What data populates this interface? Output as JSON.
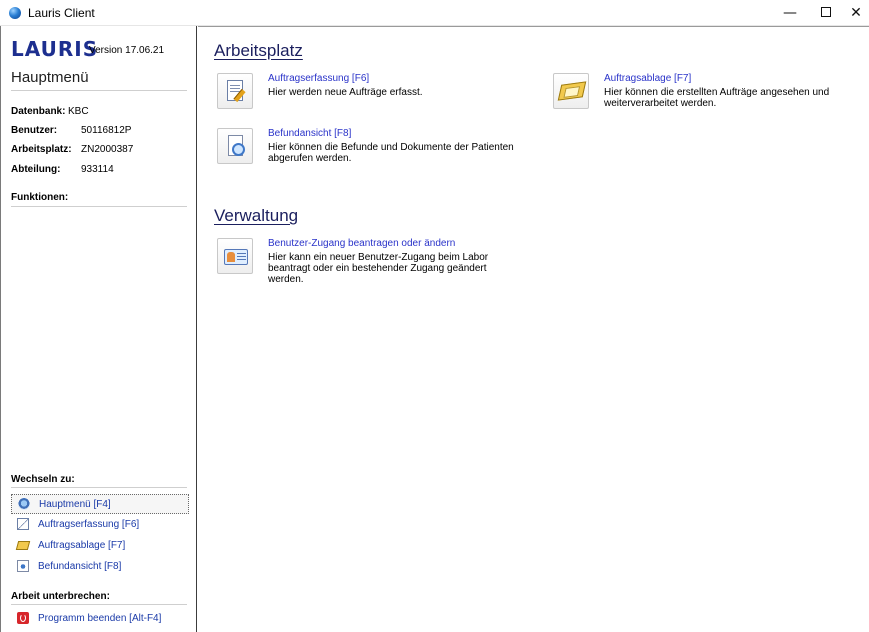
{
  "window": {
    "title": "Lauris Client",
    "controls": {
      "minimize": "—",
      "close": "✕"
    }
  },
  "sidebar": {
    "logo": "LAURIS",
    "version": "Version 17.06.21",
    "title": "Hauptmenü",
    "info": [
      {
        "label": "Datenbank:",
        "value": "KBC"
      },
      {
        "label": "Benutzer:",
        "value": "50116812P"
      },
      {
        "label": "Arbeitsplatz:",
        "value": "ZN2000387"
      },
      {
        "label": "Abteilung:",
        "value": "933114"
      }
    ],
    "functions_heading": "Funktionen:",
    "switch_heading": "Wechseln zu:",
    "nav": [
      {
        "label": "Hauptmenü [F4]",
        "icon": "home-icon",
        "selected": true
      },
      {
        "label": "Auftragserfassung [F6]",
        "icon": "edit-document-icon"
      },
      {
        "label": "Auftragsablage [F7]",
        "icon": "tray-icon"
      },
      {
        "label": "Befundansicht [F8]",
        "icon": "document-search-icon"
      }
    ],
    "interrupt_heading": "Arbeit unterbrechen:",
    "exit_label": "Programm beenden [Alt-F4]",
    "colors": {
      "logo": "#1d2f8f",
      "link": "#1a3aa8"
    }
  },
  "main": {
    "sections": [
      {
        "title": "Arbeitsplatz",
        "tiles": [
          {
            "link": "Auftragserfassung [F6]",
            "desc": "Hier werden neue Aufträge erfasst.",
            "icon": "edit-document-icon"
          },
          {
            "link": "Auftragsablage [F7]",
            "desc": "Hier können die erstellten Aufträge angesehen und weiterverarbeitet werden.",
            "icon": "tray-icon"
          },
          {
            "link": "Befundansicht [F8]",
            "desc": "Hier können die Befunde und Dokumente der Patienten abgerufen werden.",
            "icon": "document-search-icon"
          }
        ]
      },
      {
        "title": "Verwaltung",
        "tiles": [
          {
            "link": "Benutzer-Zugang beantragen oder ändern",
            "desc": "Hier kann ein neuer Benutzer-Zugang beim Labor beantragt oder ein bestehender Zugang geändert werden.",
            "icon": "id-card-icon"
          }
        ]
      }
    ],
    "colors": {
      "heading": "#1b1f5e",
      "link": "#2a33c9"
    }
  }
}
